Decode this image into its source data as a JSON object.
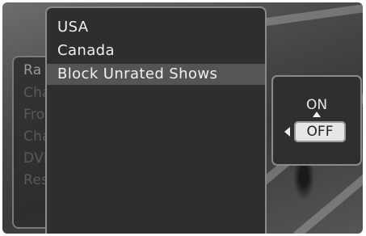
{
  "back_menu": {
    "items": [
      {
        "label": "Ra"
      },
      {
        "label": "Change Locks"
      },
      {
        "label": "Front Panel Lock"
      },
      {
        "label": "Change PIN"
      },
      {
        "label": "DVR Locks"
      },
      {
        "label": "Reset Locks"
      }
    ]
  },
  "dropdown": {
    "items": [
      {
        "label": "USA"
      },
      {
        "label": "Canada"
      },
      {
        "label": "Block Unrated Shows"
      }
    ],
    "selected_label": "Block Unrated Shows"
  },
  "toggle": {
    "on_label": "ON",
    "off_label": "OFF",
    "current_value": "OFF"
  },
  "colors": {
    "menu_bg": "#2e2e2e",
    "highlight": "#555555",
    "border": "#8a8a8a",
    "text": "#f0f0f0"
  }
}
